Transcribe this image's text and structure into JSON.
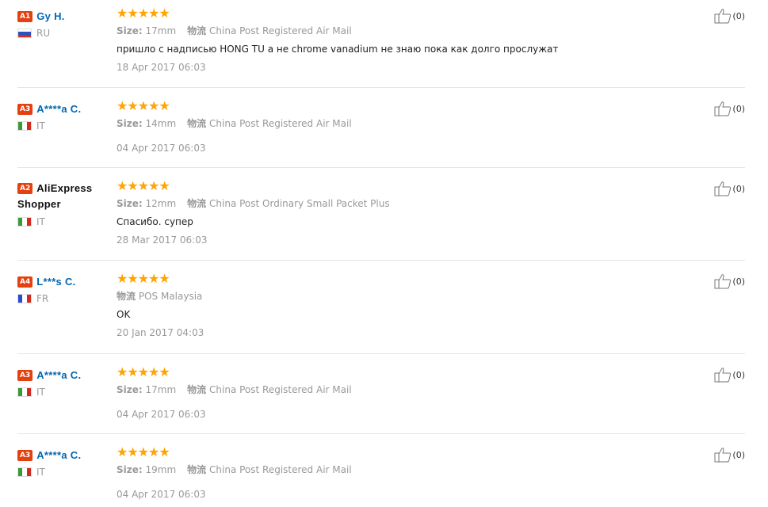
{
  "reviews": [
    {
      "badge": "A1",
      "name": "Gy H.",
      "country": "RU",
      "flag": "ru",
      "stars": "★★★★★",
      "size_label": "Size:",
      "size": "17mm",
      "ship_label": "物流",
      "ship": "China Post Registered Air Mail",
      "text": "пришло с надписью HONG TU а не chrome vanadium не знаю пока как долго прослужат",
      "date": "18 Apr 2017 06:03",
      "helpful": "(0)"
    },
    {
      "badge": "A3",
      "name": "A****a C.",
      "country": "IT",
      "flag": "it",
      "stars": "★★★★★",
      "size_label": "Size:",
      "size": "14mm",
      "ship_label": "物流",
      "ship": "China Post Registered Air Mail",
      "text": "",
      "date": "04 Apr 2017 06:03",
      "helpful": "(0)"
    },
    {
      "badge": "A2",
      "name": "AliExpress Shopper",
      "country": "IT",
      "flag": "it",
      "stars": "★★★★★",
      "size_label": "Size:",
      "size": "12mm",
      "ship_label": "物流",
      "ship": "China Post Ordinary Small Packet Plus",
      "text": "Спасибо. супер",
      "date": "28 Mar 2017 06:03",
      "helpful": "(0)"
    },
    {
      "badge": "A4",
      "name": "L***s C.",
      "country": "FR",
      "flag": "fr",
      "stars": "★★★★★",
      "size_label": "",
      "size": "",
      "ship_label": "物流",
      "ship": "POS Malaysia",
      "text": "OK",
      "date": "20 Jan 2017 04:03",
      "helpful": "(0)"
    },
    {
      "badge": "A3",
      "name": "A****a C.",
      "country": "IT",
      "flag": "it",
      "stars": "★★★★★",
      "size_label": "Size:",
      "size": "17mm",
      "ship_label": "物流",
      "ship": "China Post Registered Air Mail",
      "text": "",
      "date": "04 Apr 2017 06:03",
      "helpful": "(0)"
    },
    {
      "badge": "A3",
      "name": "A****a C.",
      "country": "IT",
      "flag": "it",
      "stars": "★★★★★",
      "size_label": "Size:",
      "size": "19mm",
      "ship_label": "物流",
      "ship": "China Post Registered Air Mail",
      "text": "",
      "date": "04 Apr 2017 06:03",
      "helpful": "(0)"
    }
  ],
  "icons": {
    "helpful": "thumbs-up-icon"
  },
  "colors": {
    "badge": "#e5400f",
    "name": "#0066b3",
    "star": "#ffa400",
    "meta": "#999999"
  }
}
